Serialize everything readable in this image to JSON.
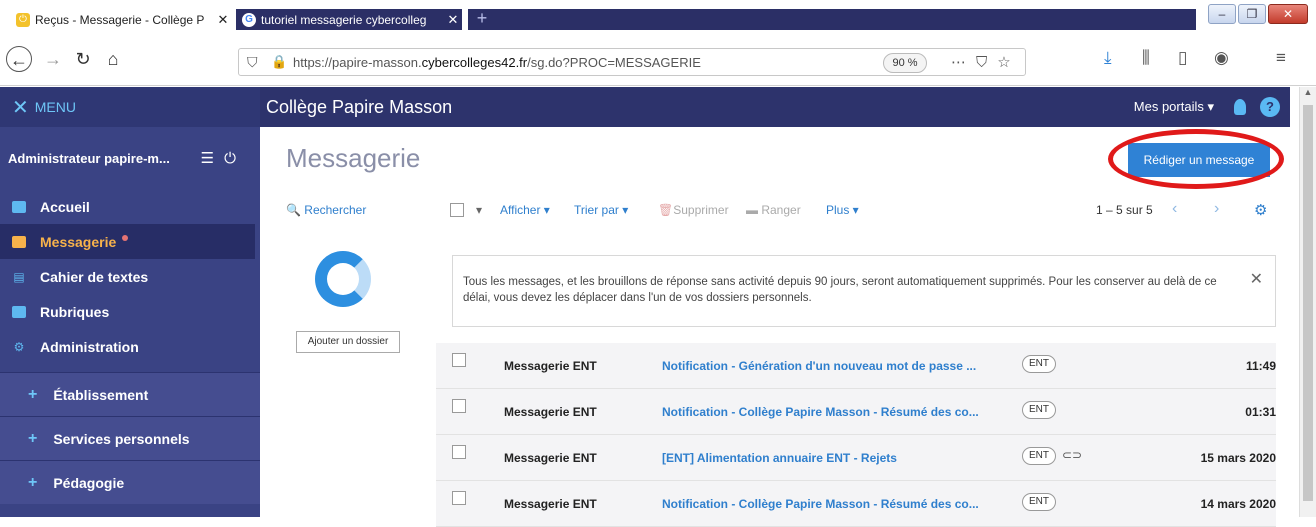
{
  "browser": {
    "tabs": [
      {
        "title": "Reçus - Messagerie - Collège P",
        "active": true
      },
      {
        "title": "tutoriel messagerie cybercolleg",
        "active": false
      }
    ],
    "url_prefix": "https://papire-masson.",
    "url_domain": "cybercolleges42.fr",
    "url_suffix": "/sg.do?PROC=MESSAGERIE",
    "zoom": "90 %"
  },
  "sidebar": {
    "menu_label": "MENU",
    "user_name": "Administrateur papire-m...",
    "items": [
      {
        "label": "Accueil",
        "icon": "grid-icon"
      },
      {
        "label": "Messagerie",
        "icon": "envelope-icon",
        "active": true
      },
      {
        "label": "Cahier de textes",
        "icon": "notebook-icon"
      },
      {
        "label": "Rubriques",
        "icon": "chat-icon"
      },
      {
        "label": "Administration",
        "icon": "gear-icon"
      }
    ],
    "groups": [
      {
        "label": "Établissement"
      },
      {
        "label": "Services personnels"
      },
      {
        "label": "Pédagogie"
      }
    ]
  },
  "header": {
    "brand": "Collège Papire Masson",
    "portals": "Mes portails",
    "help": "?"
  },
  "main": {
    "title": "Messagerie",
    "compose_label": "Rédiger un message",
    "search_label": "Rechercher",
    "add_folder_label": "Ajouter un dossier",
    "toolbar": {
      "afficher": "Afficher",
      "trier": "Trier par",
      "supprimer": "Supprimer",
      "ranger": "Ranger",
      "plus": "Plus",
      "pager": "1 – 5 sur 5"
    },
    "notice": "Tous les messages, et les brouillons de réponse sans activité depuis 90 jours, seront automatiquement supprimés. Pour les conserver au delà de ce délai, vous devez les déplacer dans l'un de vos dossiers personnels.",
    "messages": [
      {
        "from": "Messagerie ENT",
        "subject": "Notification - Génération d'un nouveau mot de passe ...",
        "badge": "ENT",
        "time": "11:49"
      },
      {
        "from": "Messagerie ENT",
        "subject": "Notification - Collège Papire Masson - Résumé des co...",
        "badge": "ENT",
        "time": "01:31"
      },
      {
        "from": "Messagerie ENT",
        "subject": "[ENT] Alimentation annuaire ENT - Rejets",
        "badge": "ENT",
        "time": "15 mars 2020",
        "attachment": true
      },
      {
        "from": "Messagerie ENT",
        "subject": "Notification - Collège Papire Masson - Résumé des co...",
        "badge": "ENT",
        "time": "14 mars 2020"
      }
    ]
  }
}
